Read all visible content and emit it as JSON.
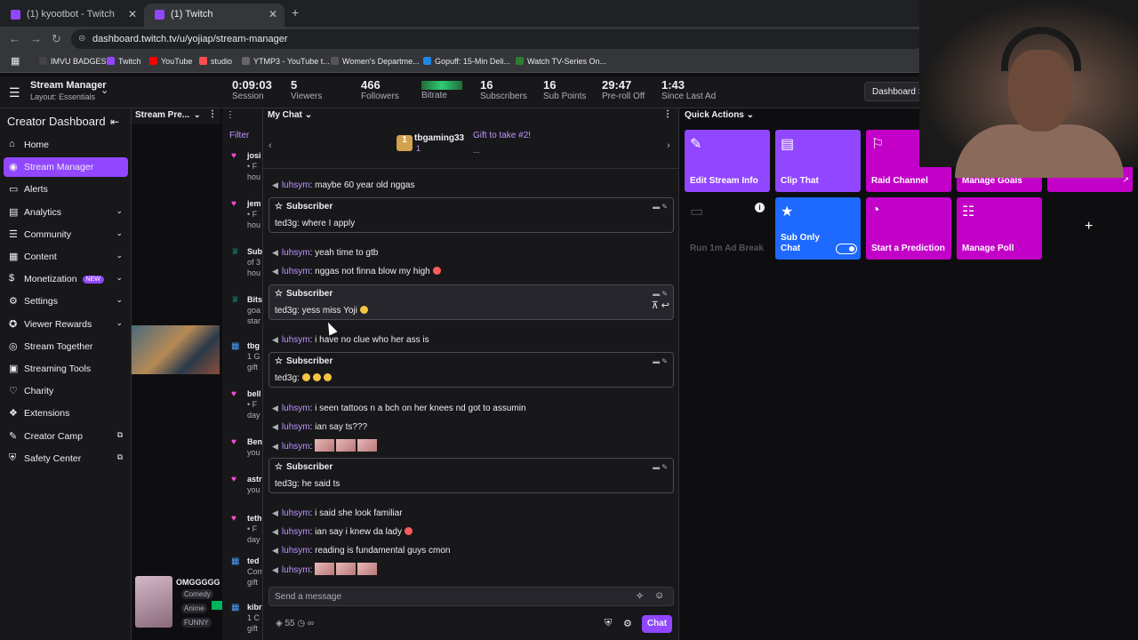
{
  "browser": {
    "tabs": [
      {
        "label": "(1) kyootbot - Twitch",
        "active": false
      },
      {
        "label": "(1) Twitch",
        "active": true
      }
    ],
    "url": "dashboard.twitch.tv/u/yojiap/stream-manager",
    "bookmarks": [
      {
        "label": "IMVU BADGES",
        "color": "#444444"
      },
      {
        "label": "Twitch",
        "color": "#9147ff"
      },
      {
        "label": "YouTube",
        "color": "#ff0000"
      },
      {
        "label": "studio",
        "color": "#ff4d4d"
      },
      {
        "label": "YTMP3 - YouTube t...",
        "color": "#666666"
      },
      {
        "label": "Women's Departme...",
        "color": "#555555"
      },
      {
        "label": "Gopuff: 15-Min Deli...",
        "color": "#1e88e5"
      },
      {
        "label": "Watch TV-Series On...",
        "color": "#2e7d32"
      }
    ]
  },
  "header": {
    "title": "Stream Manager",
    "layout": "Layout: Essentials",
    "stats": [
      {
        "value": "0:09:03",
        "label": "Session"
      },
      {
        "value": "5",
        "label": "Viewers"
      },
      {
        "value": "466",
        "label": "Followers"
      },
      {
        "value": "",
        "label": "Bitrate"
      },
      {
        "value": "16",
        "label": "Subscribers"
      },
      {
        "value": "16",
        "label": "Sub Points"
      },
      {
        "value": "29:47",
        "label": "Pre-roll Off"
      },
      {
        "value": "1:43",
        "label": "Since Last Ad"
      }
    ],
    "dashboard_button": "Dashboard S"
  },
  "sidebar": {
    "title": "Creator Dashboard",
    "items": [
      {
        "label": "Home",
        "icon": "⌂",
        "chev": false,
        "active": false
      },
      {
        "label": "Stream Manager",
        "icon": "◉",
        "chev": false,
        "active": true
      },
      {
        "label": "Alerts",
        "icon": "▭",
        "chev": false,
        "active": false
      },
      {
        "label": "Analytics",
        "icon": "▤",
        "chev": true,
        "active": false
      },
      {
        "label": "Community",
        "icon": "☰",
        "chev": true,
        "active": false
      },
      {
        "label": "Content",
        "icon": "▦",
        "chev": true,
        "active": false
      },
      {
        "label": "Monetization",
        "icon": "$",
        "chev": true,
        "active": false,
        "badge": "NEW"
      },
      {
        "label": "Settings",
        "icon": "⚙",
        "chev": true,
        "active": false
      },
      {
        "label": "Viewer Rewards",
        "icon": "✪",
        "chev": true,
        "active": false
      },
      {
        "label": "Stream Together",
        "icon": "◎",
        "chev": false,
        "active": false
      },
      {
        "label": "Streaming Tools",
        "icon": "▣",
        "chev": false,
        "active": false
      },
      {
        "label": "Charity",
        "icon": "♡",
        "chev": false,
        "active": false
      },
      {
        "label": "Extensions",
        "icon": "❖",
        "chev": false,
        "active": false
      },
      {
        "label": "Creator Camp",
        "icon": "✎",
        "chev": false,
        "active": false,
        "external": true
      },
      {
        "label": "Safety Center",
        "icon": "⛨",
        "chev": false,
        "active": false,
        "external": true
      }
    ]
  },
  "preview": {
    "title": "Stream Pre...",
    "card_name": "OMGGGGG",
    "tags": [
      "Comedy",
      "Anime",
      "FUNNY"
    ],
    "live": "Live"
  },
  "activity": {
    "filter": "Filter",
    "items": [
      {
        "icon": "♥",
        "color": "#ff4dd2",
        "title": "josi",
        "sub": "• F",
        "sub2": "hou"
      },
      {
        "icon": "♥",
        "color": "#ff4dd2",
        "title": "jem",
        "sub": "• F",
        "sub2": "hou"
      },
      {
        "icon": "♕",
        "color": "#00c8af",
        "title": "Sub",
        "sub": "of 3",
        "sub2": "hou"
      },
      {
        "icon": "♕",
        "color": "#00c8af",
        "title": "Bits",
        "sub": "goa",
        "sub2": "star"
      },
      {
        "icon": "▦",
        "color": "#4c9ffb",
        "title": "tbg",
        "sub": "1 G",
        "sub2": "gift"
      },
      {
        "icon": "♥",
        "color": "#ff4dd2",
        "title": "bell",
        "sub": "• F",
        "sub2": "day"
      },
      {
        "icon": "♥",
        "color": "#ff4dd2",
        "title": "Ben",
        "sub": "you",
        "sub2": ""
      },
      {
        "icon": "♥",
        "color": "#ff4dd2",
        "title": "astr",
        "sub": "you",
        "sub2": ""
      },
      {
        "icon": "♥",
        "color": "#ff4dd2",
        "title": "teth",
        "sub": "• F",
        "sub2": "day"
      },
      {
        "icon": "▦",
        "color": "#4c9ffb",
        "title": "ted",
        "sub": "Com",
        "sub2": "gift"
      },
      {
        "icon": "▦",
        "color": "#4c9ffb",
        "title": "kibr",
        "sub": "1 C",
        "sub2": "gift"
      }
    ]
  },
  "chat": {
    "title": "My Chat",
    "hype": {
      "gifter": "tbgaming33",
      "count": "1",
      "goal": "Gift to take #2!",
      "goal2": "..."
    },
    "messages": [
      {
        "type": "msg",
        "user": "luhsym",
        "text": ": maybe 60 year old nggas"
      },
      {
        "type": "sub",
        "label": "Subscriber",
        "user": "ted3g",
        "text": ": where I apply"
      },
      {
        "type": "msg",
        "user": "luhsym",
        "text": ": yeah time to gtb"
      },
      {
        "type": "msg",
        "user": "luhsym",
        "text": ": nggas not finna blow my high",
        "emoji": "red"
      },
      {
        "type": "sub",
        "label": "Subscriber",
        "user": "ted3g",
        "text": ": yess miss Yoji",
        "emoji": "yellow",
        "hover": true
      },
      {
        "type": "msg",
        "user": "luhsym",
        "text": ": i have no clue who her ass is"
      },
      {
        "type": "sub",
        "label": "Subscriber",
        "user": "ted3g",
        "text": ":",
        "emojis": 3
      },
      {
        "type": "msg",
        "user": "luhsym",
        "text": ": i seen tattoos n a bch on her knees nd got to assumin"
      },
      {
        "type": "msg",
        "user": "luhsym",
        "text": ": ian say ts???"
      },
      {
        "type": "msg",
        "user": "luhsym",
        "text": ":",
        "emotes": 3
      },
      {
        "type": "sub",
        "label": "Subscriber",
        "user": "ted3g",
        "text": ": he said ts"
      },
      {
        "type": "msg",
        "user": "luhsym",
        "text": ": i said she look familiar"
      },
      {
        "type": "msg",
        "user": "luhsym",
        "text": ": ian say i knew da lady",
        "emoji": "red"
      },
      {
        "type": "msg",
        "user": "luhsym",
        "text": ": reading is fundamental guys cmon"
      },
      {
        "type": "msg",
        "user": "luhsym",
        "text": ":",
        "emotes": 3
      }
    ],
    "input_placeholder": "Send a message",
    "points": "55",
    "points_extra": "∞",
    "send_label": "Chat"
  },
  "quick_actions": {
    "title": "Quick Actions",
    "tiles": [
      {
        "label": "Edit Stream Info",
        "icon": "✎",
        "color": "#9147ff"
      },
      {
        "label": "Clip That",
        "icon": "▤",
        "color": "#9147ff"
      },
      {
        "label": "Raid Channel",
        "icon": "⚐",
        "color": "#c300c8"
      },
      {
        "label": "Manage Goals",
        "icon": "◎",
        "color": "#c300c8"
      },
      {
        "label": "Stream Together",
        "icon": "",
        "color": "#c300c8",
        "external": true
      },
      {
        "label": "Run 1m Ad Break",
        "icon": "▭",
        "color": "#0e0e10",
        "disabled": true
      },
      {
        "label": "Sub Only Chat",
        "icon": "★",
        "color": "#1e69ff",
        "toggle": true
      },
      {
        "label": "Start a Prediction",
        "icon": "◔",
        "color": "#c300c8"
      },
      {
        "label": "Manage Poll",
        "icon": "☷",
        "color": "#c300c8"
      },
      {
        "label": "+",
        "icon": "",
        "color": "#0e0e10",
        "add": true
      }
    ]
  }
}
